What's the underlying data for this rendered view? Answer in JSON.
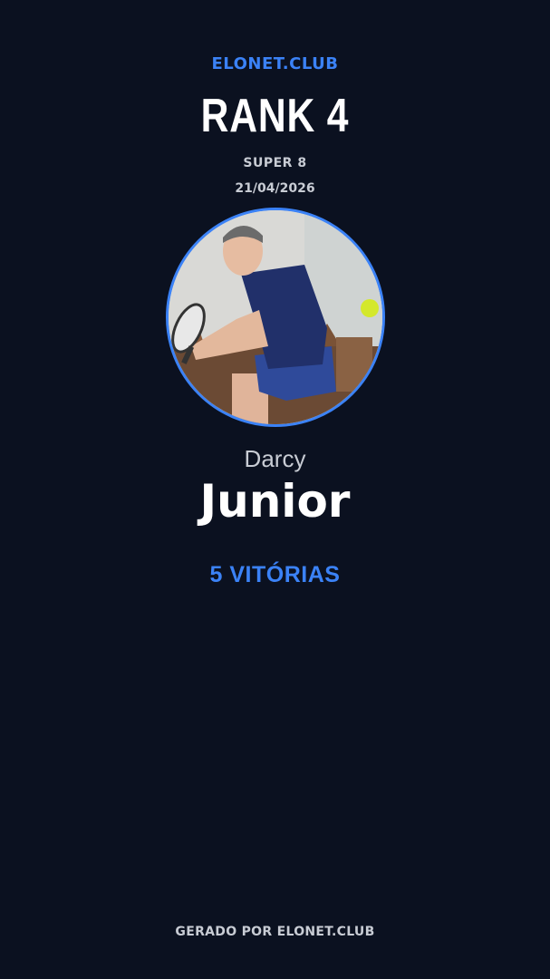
{
  "brand": "ELONET.CLUB",
  "rank_label": "RANK 4",
  "event_name": "SUPER 8",
  "date": "21/04/2026",
  "player": {
    "first_name": "Darcy",
    "last_name": "Junior",
    "photo_icon": "player-photo"
  },
  "wins_label": "5 VITÓRIAS",
  "footer": "GERADO POR ELONET.CLUB",
  "colors": {
    "background": "#0b1120",
    "accent": "#3b82f6",
    "text_primary": "#ffffff",
    "text_secondary": "#c8ccd4"
  }
}
